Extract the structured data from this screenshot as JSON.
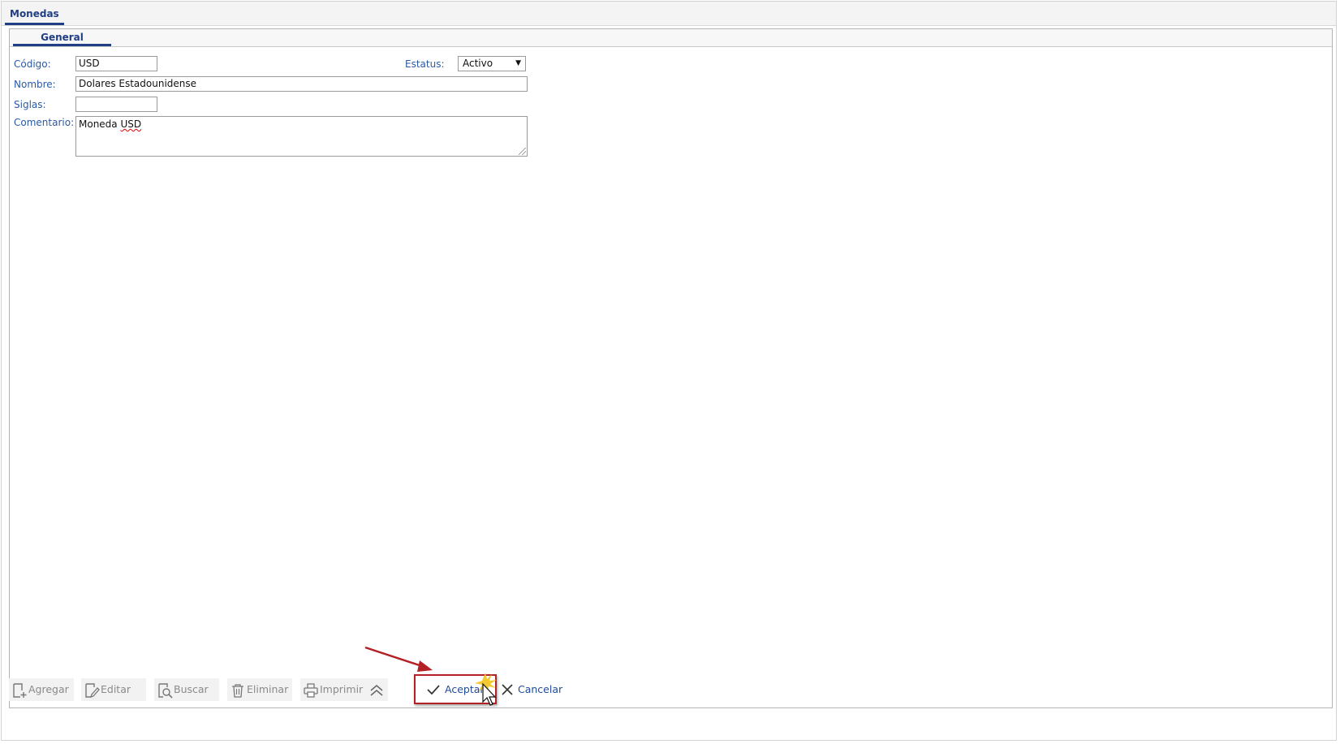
{
  "tabs": {
    "main": "Monedas",
    "sub": "General"
  },
  "form": {
    "codigo": {
      "label": "Código:",
      "value": "USD"
    },
    "estatus": {
      "label": "Estatus:",
      "value": "Activo"
    },
    "nombre": {
      "label": "Nombre:",
      "value": "Dolares Estadounidense"
    },
    "siglas": {
      "label": "Siglas:",
      "value": ""
    },
    "comentario": {
      "label": "Comentario:",
      "value_word1": "Moneda",
      "value_word2": "USD"
    }
  },
  "toolbar": {
    "agregar": "Agregar",
    "editar": "Editar",
    "buscar": "Buscar",
    "eliminar": "Eliminar",
    "imprimir": "Imprimir",
    "aceptar": "Aceptar",
    "cancelar": "Cancelar"
  },
  "colors": {
    "accent": "#1f3e85",
    "label": "#2a5aa6",
    "annotation": "#b32025"
  },
  "icons": [
    "add-icon",
    "edit-icon",
    "search-icon",
    "trash-icon",
    "print-icon",
    "collapse-icon",
    "check-icon",
    "close-icon",
    "cursor-icon",
    "arrow-annotation"
  ]
}
